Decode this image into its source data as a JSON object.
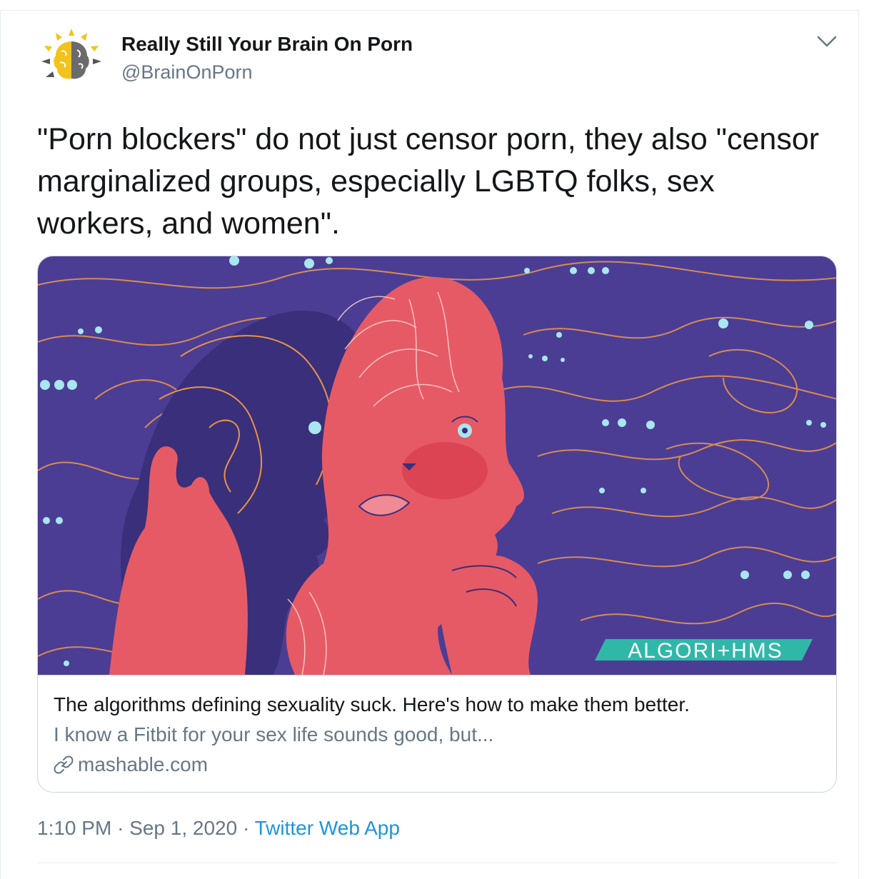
{
  "tweet": {
    "author": {
      "display_name": "Really Still Your Brain On Porn",
      "handle": "@BrainOnPorn",
      "avatar_icon": "brain-sun-logo-icon"
    },
    "menu_icon": "chevron-down-icon",
    "text": "\"Porn blockers\" do not just censor porn, they also \"censor marginalized groups, especially LGBTQ folks, sex workers, and women\".",
    "card": {
      "image_caption_text": "ALGORI+HMS",
      "title": "The algorithms defining sexuality suck. Here's how to make them better.",
      "description": "I know a Fitbit for your sex life sounds good, but...",
      "domain": "mashable.com",
      "domain_icon": "link-icon"
    },
    "time": "1:10 PM",
    "separator": "·",
    "date": "Sep 1, 2020",
    "source": "Twitter Web App"
  },
  "colors": {
    "text_primary": "#14171a",
    "text_secondary": "#657786",
    "link": "#1b95e0",
    "border": "#ccd6dd",
    "illustration_background": "#4b3d94",
    "illustration_figure": "#e65a66",
    "illustration_lines": "#e8944a",
    "illustration_dots": "#a8e6f0"
  }
}
